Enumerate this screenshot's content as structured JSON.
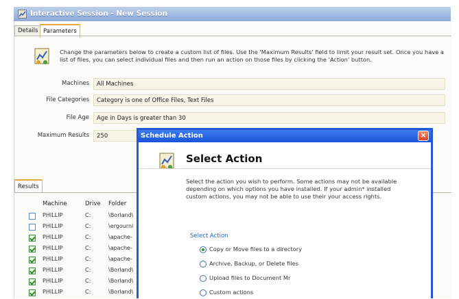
{
  "window": {
    "title": "Interactive Session - New Session"
  },
  "tabs": [
    {
      "label": "Details"
    },
    {
      "label": "Parameters"
    }
  ],
  "description": "Change the parameters below to create a custom list of files.  Use the 'Maximum Results' field to limit your result set. Once you have a list of files, you can select individual files and then run an action on those files by clicking the 'Action' button.",
  "fields": [
    {
      "label": "Machines",
      "value": "All Machines"
    },
    {
      "label": "File Categories",
      "value": "Category is one of Office Files, Text Files"
    },
    {
      "label": "File Age",
      "value": "Age in Days is greater than 30"
    },
    {
      "label": "Maximum Results",
      "value": "250"
    }
  ],
  "results": {
    "tab_label": "Results",
    "columns": [
      "Machine",
      "Drive",
      "Folder"
    ],
    "rows": [
      {
        "checked": false,
        "machine": "PHILLIP",
        "drive": "C:",
        "folder": "\\Borland\\"
      },
      {
        "checked": false,
        "machine": "PHILLIP",
        "drive": "C:",
        "folder": "\\ergourni"
      },
      {
        "checked": true,
        "machine": "PHILLIP",
        "drive": "C:",
        "folder": "\\apache-"
      },
      {
        "checked": true,
        "machine": "PHILLIP",
        "drive": "C:",
        "folder": "\\apache-"
      },
      {
        "checked": true,
        "machine": "PHILLIP",
        "drive": "C:",
        "folder": "\\apache-"
      },
      {
        "checked": true,
        "machine": "PHILLIP",
        "drive": "C:",
        "folder": "\\Borland\\"
      },
      {
        "checked": true,
        "machine": "PHILLIP",
        "drive": "C:",
        "folder": "\\Borland\\"
      },
      {
        "checked": true,
        "machine": "PHILLIP",
        "drive": "C:",
        "folder": "\\Borland\\"
      }
    ]
  },
  "dialog": {
    "title": "Schedule Action",
    "close_label": "×",
    "heading": "Select Action",
    "description": "Select the action you wish to perform. Some actions may not be available depending on which options you have installed. If your admin* installed custom actions, you may not be able to use their your access rights.",
    "group_label": "Select Action",
    "options": [
      {
        "label": "Copy or Move files to a directory",
        "selected": true
      },
      {
        "label": "Archive, Backup, or Delete files",
        "selected": false
      },
      {
        "label": "Upload files to Document Mr",
        "selected": false
      },
      {
        "label": "Custom actions",
        "selected": false
      }
    ]
  },
  "colors": {
    "title_blue": "#1a56d9",
    "check_green": "#2e8b2e",
    "field_bg": "#f7f5e7"
  },
  "icons": {
    "app": "wizard-icon",
    "params": "wizard-icon",
    "dialog": "wizard-icon",
    "close": "close-icon"
  }
}
